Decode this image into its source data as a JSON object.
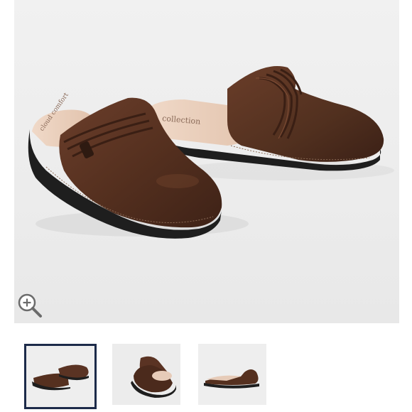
{
  "gallery": {
    "main_image_alt": "",
    "zoom_icon": "magnifier-plus-icon",
    "selected_index": 0,
    "thumbnails": [
      {
        "view": "pair-side-view",
        "selected": true
      },
      {
        "view": "pair-angled-view",
        "selected": false
      },
      {
        "view": "single-side-view",
        "selected": false
      }
    ]
  },
  "colors": {
    "leather": "#5a3323",
    "sole": "#1e1e1e",
    "footbed": "#e6cbb8",
    "selected_border": "#1d2b4a"
  },
  "insole_text": {
    "left": "cloud comfort",
    "right": "collection"
  }
}
